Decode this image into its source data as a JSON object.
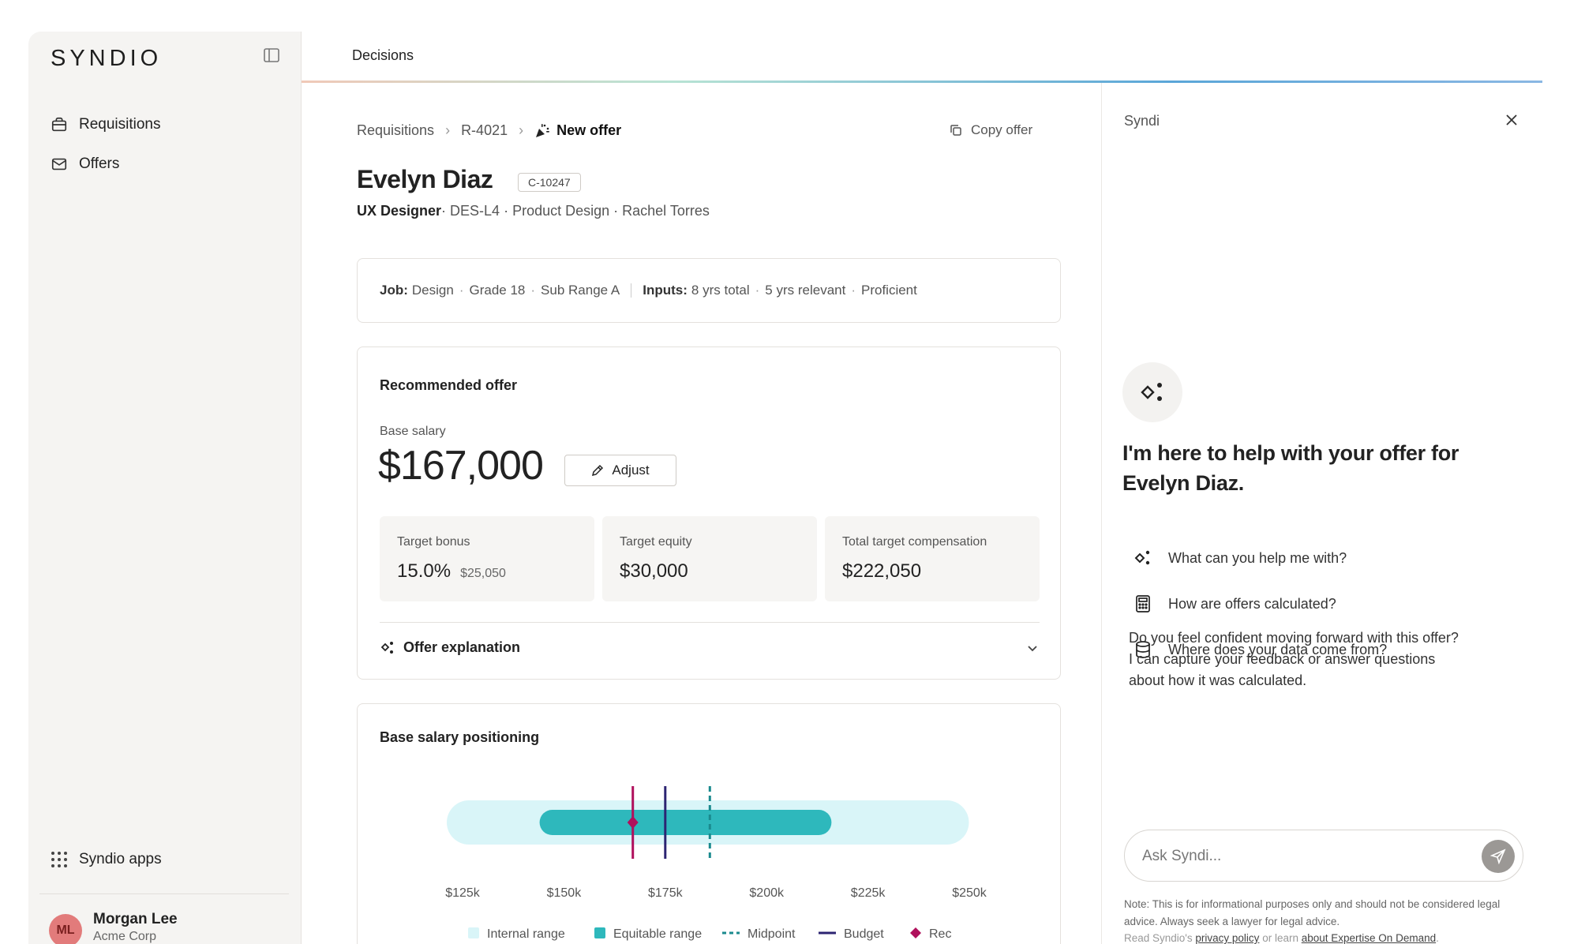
{
  "sidebar": {
    "logo": "SYNDIO",
    "items": [
      {
        "label": "Requisitions",
        "icon": "briefcase-icon"
      },
      {
        "label": "Offers",
        "icon": "mail-icon"
      }
    ],
    "apps_label": "Syndio apps",
    "user": {
      "initials": "ML",
      "name": "Morgan Lee",
      "org": "Acme Corp"
    }
  },
  "topbar": {
    "title": "Decisions"
  },
  "breadcrumb": {
    "items": [
      "Requisitions",
      "R-4021"
    ],
    "current": "New offer"
  },
  "copy_offer_label": "Copy offer",
  "candidate": {
    "name": "Evelyn Diaz",
    "id": "C-10247",
    "title": "UX Designer",
    "meta": "· DES-L4 · Product Design · Rachel Torres"
  },
  "job_card": {
    "job_label": "Job:",
    "job_items": [
      "Design",
      "Grade 18",
      "Sub Range A"
    ],
    "inputs_label": "Inputs:",
    "inputs_items": [
      "8 yrs total",
      "5 yrs relevant",
      "Proficient"
    ]
  },
  "recommended": {
    "title": "Recommended offer",
    "base_label": "Base salary",
    "base_value": "$167,000",
    "adjust_label": "Adjust",
    "tiles": [
      {
        "label": "Target bonus",
        "value": "15.0%",
        "extra": "$25,050"
      },
      {
        "label": "Target equity",
        "value": "$30,000",
        "extra": ""
      },
      {
        "label": "Total target compensation",
        "value": "$222,050",
        "extra": ""
      }
    ],
    "explanation_label": "Offer explanation"
  },
  "positioning": {
    "title": "Base salary positioning"
  },
  "chart_data": {
    "type": "range",
    "x": [
      125000,
      150000,
      175000,
      200000,
      225000,
      250000
    ],
    "tick_labels": [
      "$125k",
      "$150k",
      "$175k",
      "$200k",
      "$225k",
      "$250k"
    ],
    "xlim": [
      125000,
      250000
    ],
    "internal_range": [
      125000,
      246000
    ],
    "equitable_range": [
      144000,
      216000
    ],
    "midpoint": 186000,
    "budget": 175000,
    "rec": 167000,
    "legend": [
      "Internal range",
      "Equitable range",
      "Midpoint",
      "Budget",
      "Rec"
    ],
    "colors": {
      "internal": "#d9f5f8",
      "equitable": "#2eb8bc",
      "midpoint": "#1a8a8e",
      "budget": "#2c2472",
      "rec": "#b0105c"
    },
    "legend_position": "bottom"
  },
  "panel": {
    "title": "Syndi",
    "heading": "I'm here to help with your offer for Evelyn Diaz.",
    "suggestions": [
      {
        "label": "What can you help me with?",
        "icon": "sparkle-icon"
      },
      {
        "label": "How are offers calculated?",
        "icon": "calculator-icon"
      },
      {
        "label": "Where does your data come from?",
        "icon": "database-icon"
      }
    ],
    "message": "Do you feel confident moving forward with this offer? I can capture your feedback or answer questions about how it was calculated.",
    "input_placeholder": "Ask Syndi...",
    "note": "Note: This is for informational purposes only and should not be considered legal advice. Always seek a lawyer for legal advice.",
    "read_prefix": "Read Syndio's",
    "privacy_link": "privacy policy",
    "or_learn": "or learn",
    "expertise_link": "about Expertise On Demand",
    "period": "."
  }
}
